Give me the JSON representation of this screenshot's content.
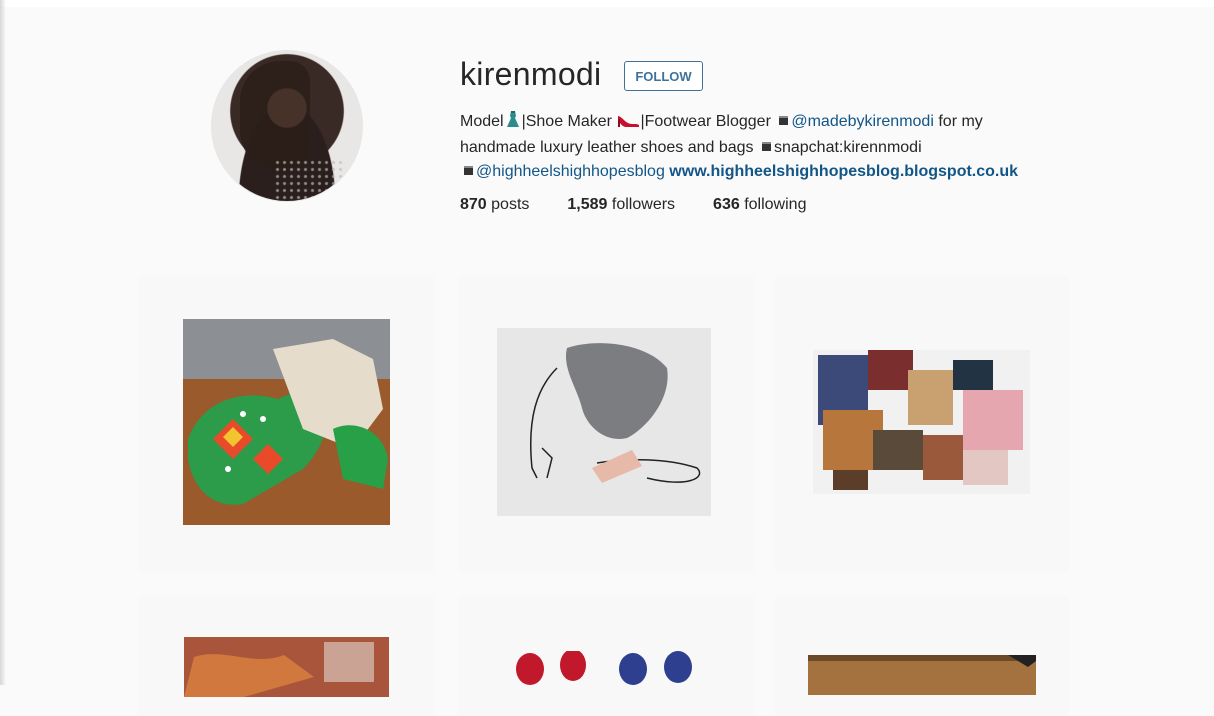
{
  "profile": {
    "username": "kirenmodi",
    "follow_label": "FOLLOW",
    "bio": {
      "line1_prefix": "Model",
      "line1_shoe_maker": "|Shoe Maker",
      "line1_blogger": "|Footwear Blogger",
      "line1_handle": "@madebykirenmodi",
      "line1_suffix": "for my",
      "line2_text": "handmade luxury leather shoes and bags",
      "line2_snapchat": "snapchat:kirennmodi",
      "line3_handle": "@highheelshighhopesblog",
      "line3_url": "www.highheelshighhopesblog.blogspot.co.uk"
    },
    "stats": {
      "posts_count": "870",
      "posts_label": "posts",
      "followers_count": "1,589",
      "followers_label": "followers",
      "following_count": "636",
      "following_label": "following"
    }
  },
  "icons": {
    "dress": "dress-icon",
    "heel": "high-heel-icon",
    "square": "black-square-icon"
  },
  "colors": {
    "link": "#125688",
    "follow_border": "#3f729b",
    "background": "#fafafa"
  }
}
